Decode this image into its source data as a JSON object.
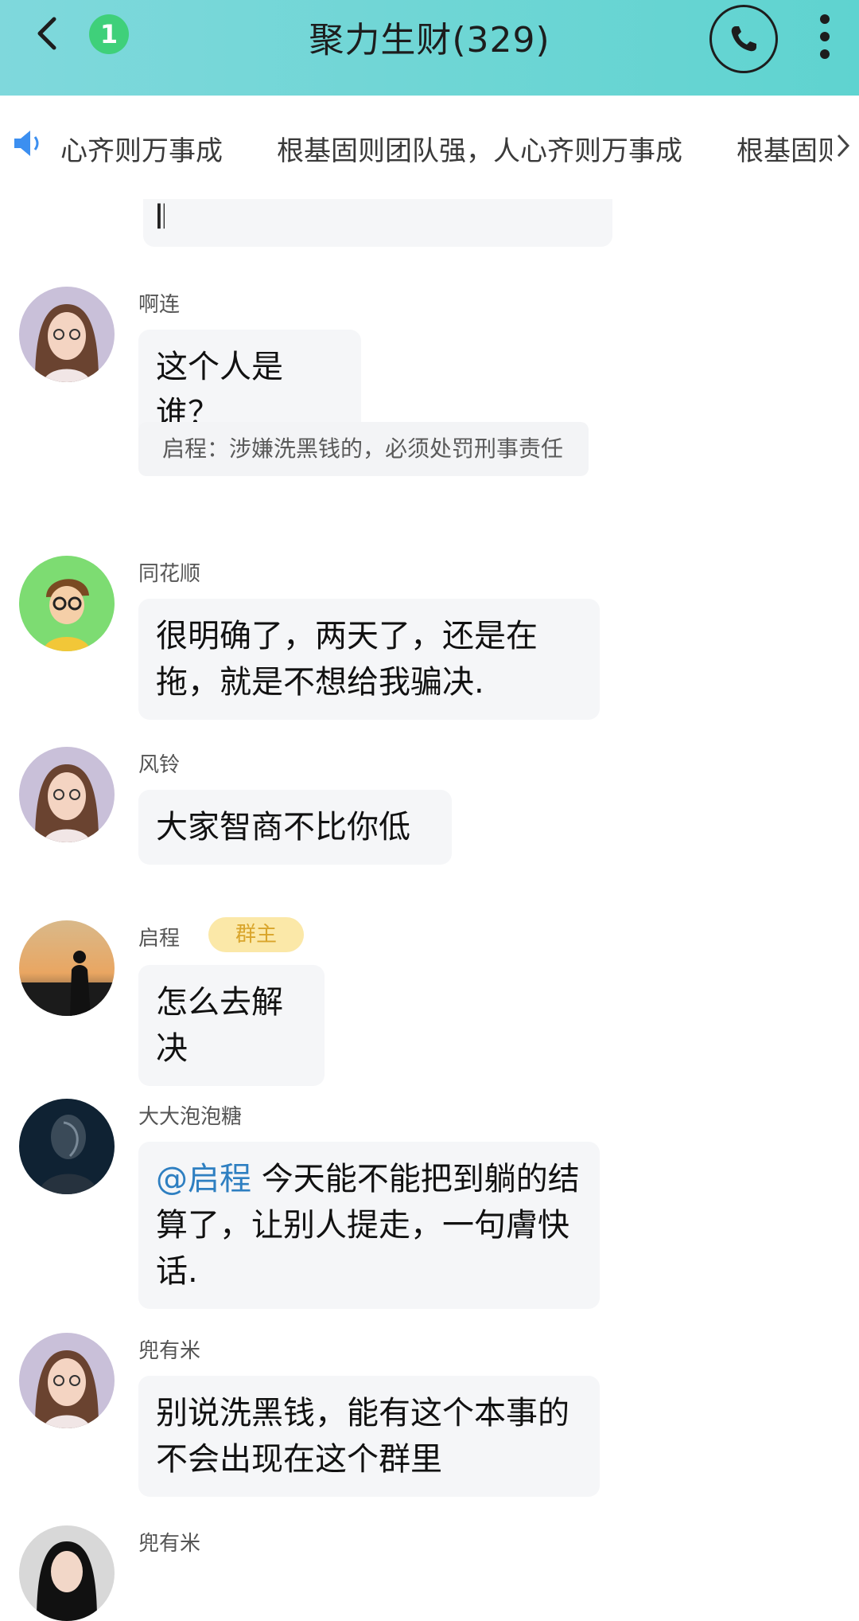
{
  "header": {
    "title": "聚力生财(329)",
    "unread_count": "1",
    "colors": {
      "bar": "#6fd6d5",
      "unread": "#3fd07a"
    }
  },
  "notice": {
    "text": "心齐则万事成　　根基固则团队强，人心齐则万事成　　根基固则团队强"
  },
  "chat": {
    "fragment_text": "𝄃",
    "messages": [
      {
        "sender": "啊连",
        "text": "这个人是谁？",
        "quote": "启程：涉嫌洗黑钱的，必须处罚刑事责任",
        "avatar": "woman-avatar"
      },
      {
        "sender": "同花顺",
        "text": "很明确了，两天了，还是在拖，就是不想给我骗决.",
        "avatar": "cartoon-boy-avatar"
      },
      {
        "sender": "风铃",
        "text": "大家智商不比你低",
        "avatar": "woman-avatar"
      },
      {
        "sender": "启程",
        "role": "群主",
        "text": "怎么去解决",
        "avatar": "sunset-silhouette-avatar"
      },
      {
        "sender": "大大泡泡糖",
        "mention": "@启程",
        "text": " 今天能不能把到躺的结算了，让别人提走，一句膚快话.",
        "avatar": "dark-portrait-avatar"
      },
      {
        "sender": "兜有米",
        "text": "别说洗黑钱，能有这个本事的不会出现在这个群里",
        "avatar": "woman-avatar"
      },
      {
        "sender": "兜有米",
        "avatar": "woman-dark-avatar"
      }
    ]
  }
}
